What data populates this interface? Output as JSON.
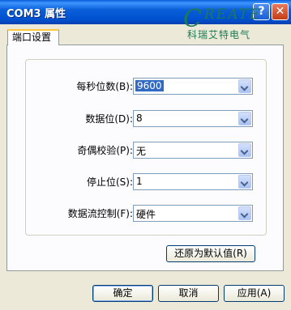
{
  "window": {
    "title": "COM3 属性",
    "help_label": "?",
    "close_label": "✕"
  },
  "logo": {
    "initial": "C",
    "latin": "REATE",
    "chinese": "科瑞艾特电气"
  },
  "tabs": [
    {
      "label": "端口设置"
    }
  ],
  "settings": [
    {
      "label": "每秒位数(B):",
      "value": "9600",
      "selected": true
    },
    {
      "label": "数据位(D):",
      "value": "8"
    },
    {
      "label": "奇偶校验(P):",
      "value": "无"
    },
    {
      "label": "停止位(S):",
      "value": "1"
    },
    {
      "label": "数据流控制(F):",
      "value": "硬件"
    }
  ],
  "restore_defaults_label": "还原为默认值(R)",
  "footer": {
    "ok_label": "确定",
    "cancel_label": "取消",
    "apply_label": "应用(A)"
  }
}
